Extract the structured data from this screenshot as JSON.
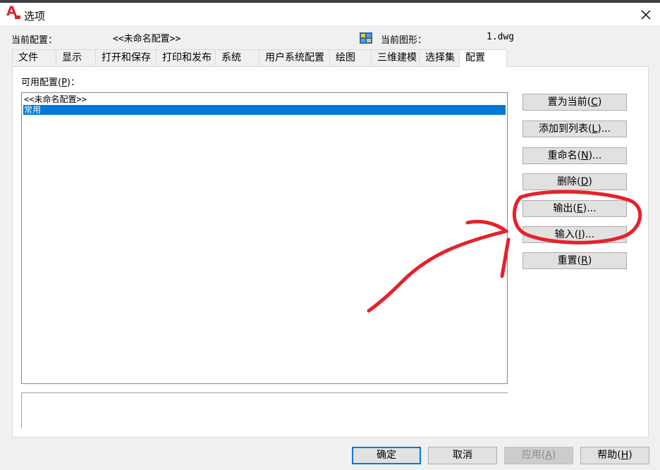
{
  "window": {
    "title": "选项",
    "close_icon": "close-icon",
    "logo_icon": "autocad-logo-icon"
  },
  "header": {
    "current_profile_label": "当前配置：",
    "current_profile_value": "<<未命名配置>>",
    "current_drawing_label": "当前图形：",
    "current_drawing_value": "1.dwg",
    "drawing_icon": "drawing-file-icon"
  },
  "tabs": [
    {
      "label": "文件"
    },
    {
      "label": "显示"
    },
    {
      "label": "打开和保存"
    },
    {
      "label": "打印和发布"
    },
    {
      "label": "系统"
    },
    {
      "label": "用户系统配置"
    },
    {
      "label": "绘图"
    },
    {
      "label": "三维建模"
    },
    {
      "label": "选择集"
    },
    {
      "label": "配置"
    }
  ],
  "active_tab": "配置",
  "profiles": {
    "label_pre": "可用配置(",
    "label_key": "P",
    "label_post": ")：",
    "items": [
      "<<未命名配置>>",
      "常用"
    ],
    "selected": "常用"
  },
  "side_buttons": [
    {
      "pre": "置为当前(",
      "key": "C",
      "post": ")"
    },
    {
      "pre": "添加到列表(",
      "key": "L",
      "post": ")..."
    },
    {
      "pre": "重命名(",
      "key": "N",
      "post": ")..."
    },
    {
      "pre": "删除(",
      "key": "D",
      "post": ")"
    },
    {
      "pre": "输出(",
      "key": "E",
      "post": ")..."
    },
    {
      "pre": "输入(",
      "key": "I",
      "post": ")..."
    },
    {
      "pre": "重置(",
      "key": "R",
      "post": ")"
    }
  ],
  "footer_buttons": {
    "ok": {
      "label": "确定"
    },
    "cancel": {
      "label": "取消"
    },
    "apply": {
      "pre": "应用(",
      "key": "A",
      "post": ")"
    },
    "help": {
      "pre": "帮助(",
      "key": "H",
      "post": ")"
    }
  },
  "colors": {
    "selection": "#0078d7",
    "annotation": "#e8202a",
    "logo": "#d8232a"
  }
}
